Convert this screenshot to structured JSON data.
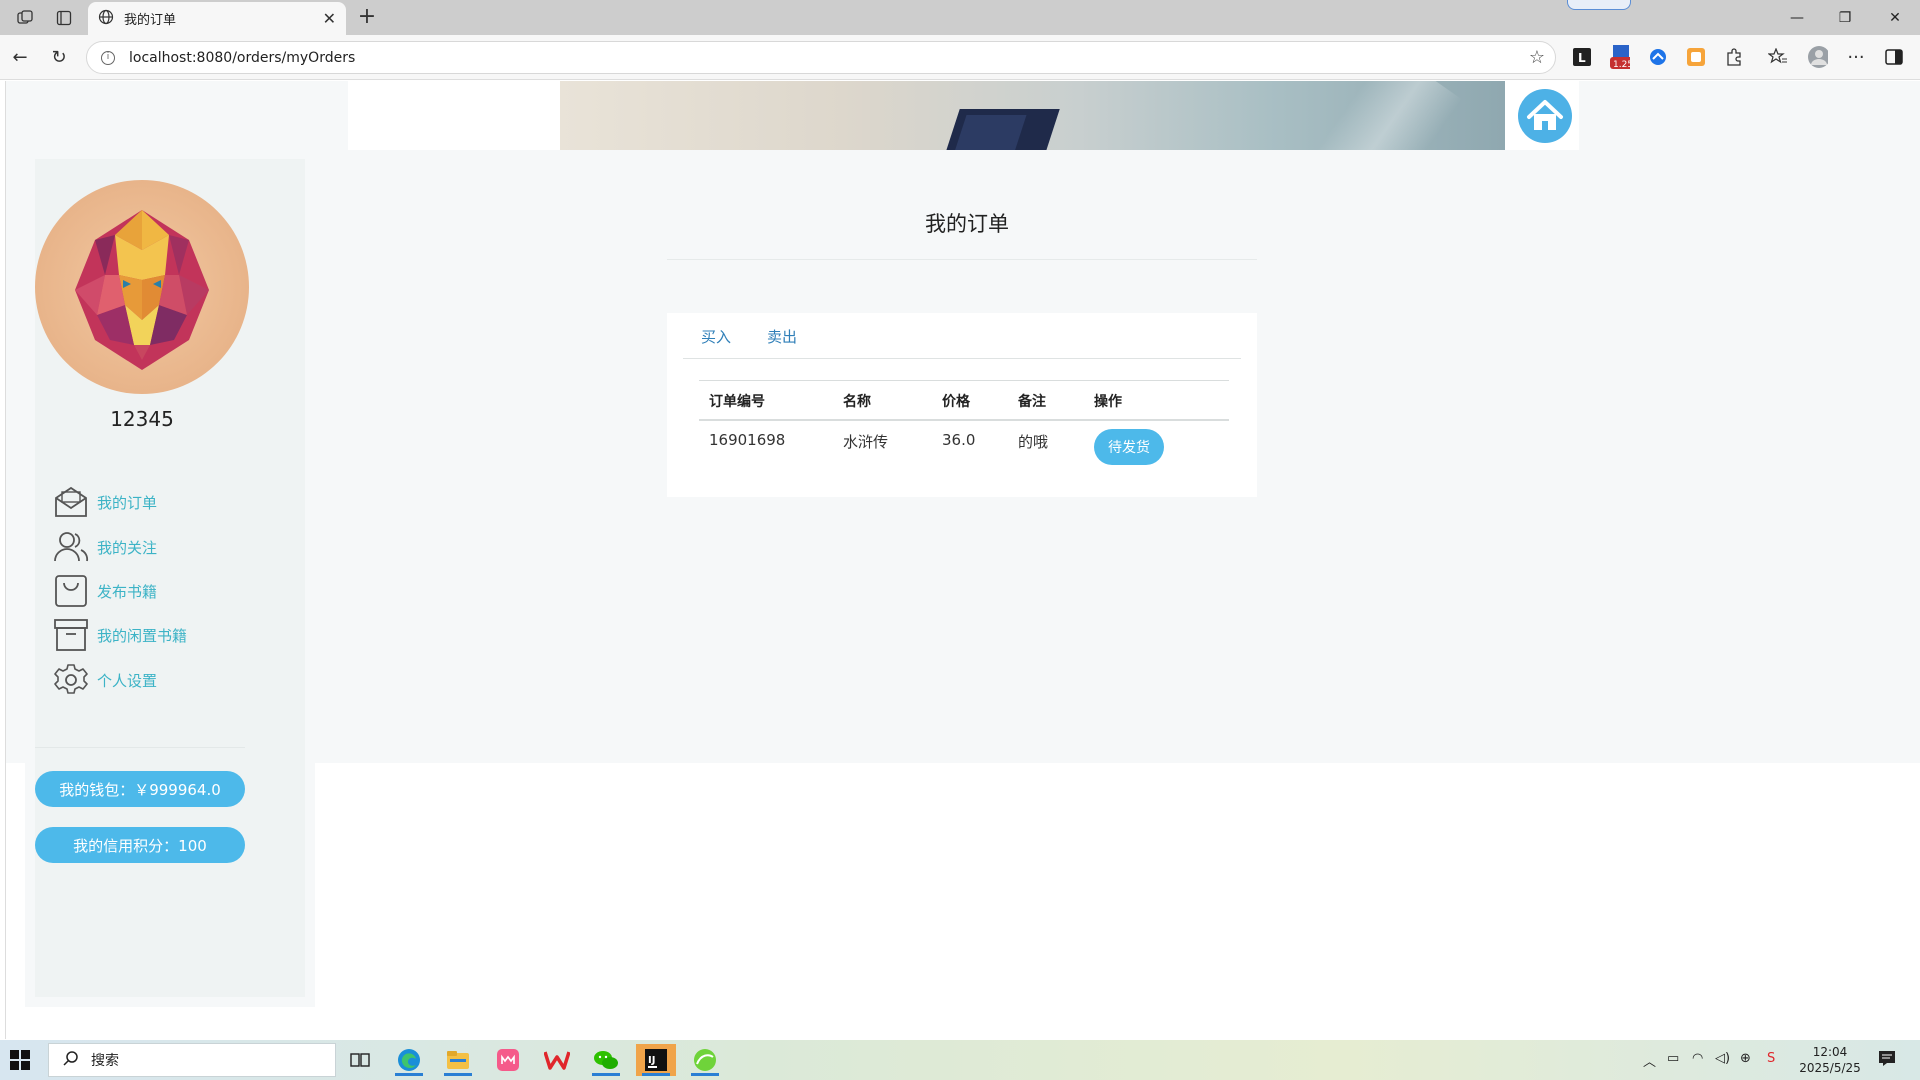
{
  "browser": {
    "tab_title": "我的订单",
    "url": "localhost:8080/orders/myOrders",
    "extension_badge": "1.25"
  },
  "sidebar": {
    "username": "12345",
    "menu": [
      {
        "label": "我的订单",
        "icon": "envelope-icon"
      },
      {
        "label": "我的关注",
        "icon": "users-icon"
      },
      {
        "label": "发布书籍",
        "icon": "bag-icon"
      },
      {
        "label": "我的闲置书籍",
        "icon": "archive-icon"
      },
      {
        "label": "个人设置",
        "icon": "gear-icon"
      }
    ],
    "wallet_label": "我的钱包：￥999964.0",
    "credit_label": "我的信用积分：100"
  },
  "main": {
    "title": "我的订单",
    "tabs": [
      "买入",
      "卖出"
    ],
    "table": {
      "headers": [
        "订单编号",
        "名称",
        "价格",
        "备注",
        "操作"
      ],
      "rows": [
        {
          "order_id": "16901698",
          "name": "水浒传",
          "price": "36.0",
          "note": "的哦",
          "action": "待发货"
        }
      ]
    }
  },
  "taskbar": {
    "search_placeholder": "搜索",
    "time": "12:04",
    "date": "2025/5/25"
  },
  "colors": {
    "accent": "#4db9ea",
    "menu_text": "#3cb3c6",
    "tab_link": "#2f7fb8"
  }
}
